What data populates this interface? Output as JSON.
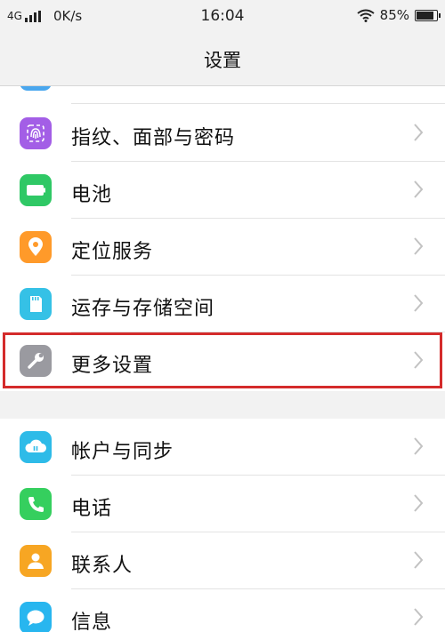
{
  "status_bar": {
    "network": "4G",
    "speed": "0K/s",
    "time": "16:04",
    "battery": "85%",
    "battery_level": 0.85
  },
  "title": "设置",
  "group1": [
    {
      "label": "指纹、面部与密码",
      "icon": "fingerprint-icon",
      "color": "#a35ee6"
    },
    {
      "label": "电池",
      "icon": "battery-icon",
      "color": "#2fc865"
    },
    {
      "label": "定位服务",
      "icon": "location-pin-icon",
      "color": "#ff9a2a"
    },
    {
      "label": "运存与存储空间",
      "icon": "sd-card-icon",
      "color": "#35c1e6"
    },
    {
      "label": "更多设置",
      "icon": "wrench-icon",
      "color": "#9a9aa0"
    }
  ],
  "group2": [
    {
      "label": "帐户与同步",
      "icon": "cloud-sync-icon",
      "color": "#2ebbe8"
    },
    {
      "label": "电话",
      "icon": "phone-icon",
      "color": "#35cf5e"
    },
    {
      "label": "联系人",
      "icon": "contact-icon",
      "color": "#f7a623"
    },
    {
      "label": "信息",
      "icon": "message-icon",
      "color": "#28b6ef"
    }
  ],
  "highlighted_item": "更多设置"
}
